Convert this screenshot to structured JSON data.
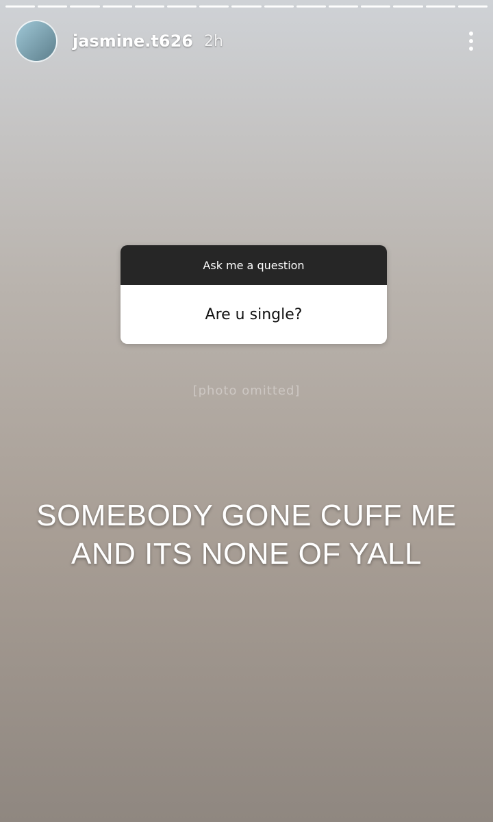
{
  "story": {
    "progress_segments": 15,
    "username": "jasmine.t626",
    "timestamp": "2h"
  },
  "question_sticker": {
    "title": "Ask me a question",
    "answer": "Are u single?"
  },
  "caption": {
    "line1": "SOMEBODY GONE CUFF ME",
    "line2": "AND ITS NONE OF YALL"
  },
  "placeholder_note": "[photo omitted]",
  "colors": {
    "sticker_header": "#262626",
    "sticker_body": "#ffffff"
  }
}
